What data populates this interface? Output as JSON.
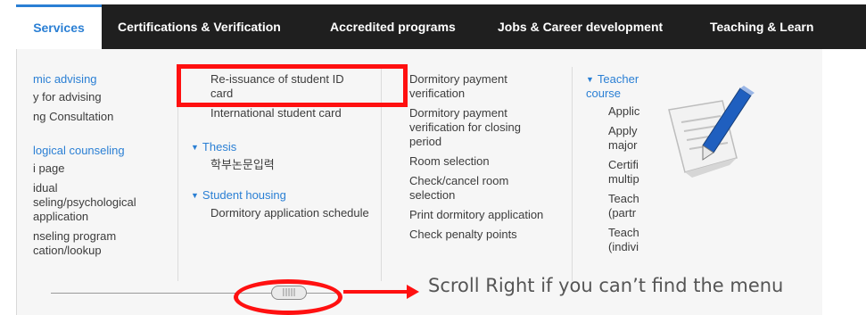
{
  "nav": [
    "Services",
    "Certifications & Verification",
    "Accredited programs",
    "Jobs & Career development",
    "Teaching & Learn"
  ],
  "col1": [
    "mic advising",
    "y for advising",
    "ng Consultation",
    "logical counseling",
    "i page",
    "idual",
    "seling/psychological",
    "application",
    "nseling program",
    "cation/lookup"
  ],
  "col2": [
    "Re-issuance of student ID card",
    "International student card",
    "Thesis",
    "학부논문입력",
    "Student housing",
    "Dormitory application schedule"
  ],
  "col3": [
    "Dormitory payment verification",
    "Dormitory payment verification for closing period",
    "Room selection",
    "Check/cancel room selection",
    "Print dormitory application",
    "Check penalty points"
  ],
  "col4": [
    "Teacher course",
    "Applic",
    "Apply major",
    "Certifi multip",
    "Teach (partr",
    "Teach (indivi"
  ],
  "hint": "Scroll Right if you can’t find the menu",
  "colors": {
    "accent": "#2a7fd4",
    "nav_bg": "#1f1f1f",
    "annotation": "#ff1010"
  }
}
